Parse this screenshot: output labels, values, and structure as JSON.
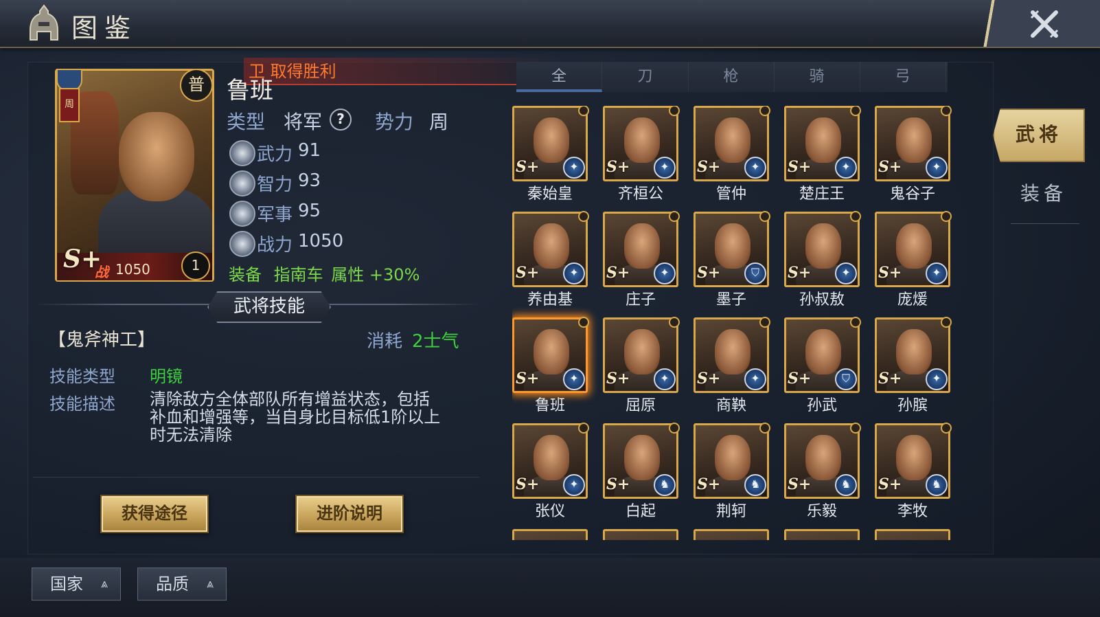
{
  "header": {
    "title": "图鉴",
    "close_label": "✕"
  },
  "banner": {
    "text": "卫 取得胜利"
  },
  "hero": {
    "name": "鲁班",
    "type_label": "类型",
    "type_value": "将军",
    "faction_label": "势力",
    "faction_value": "周",
    "rarity_badge": "普",
    "faction_badge": "周",
    "grade": "S+",
    "power_icon": "战",
    "power_value": "1050",
    "level": "1",
    "stats": [
      {
        "label": "武力",
        "value": "91",
        "icon": "sword-icon"
      },
      {
        "label": "智力",
        "value": "93",
        "icon": "scroll-icon"
      },
      {
        "label": "军事",
        "value": "95",
        "icon": "banner-icon"
      },
      {
        "label": "战力",
        "value": "1050",
        "icon": "blade-icon"
      }
    ],
    "equip_label": "装备",
    "equip_value": "指南车",
    "attr_label": "属性",
    "attr_value": "+30%"
  },
  "skill": {
    "tab_label": "武将技能",
    "name": "【鬼斧神工】",
    "cost_label": "消耗",
    "cost_value": "2士气",
    "type_label": "技能类型",
    "type_value": "明镜",
    "desc_label": "技能描述",
    "desc_value": "清除敌方全体部队所有增益状态，包括补血和增强等，当自身比目标低1阶以上时无法清除"
  },
  "buttons": {
    "obtain": "获得途径",
    "advance": "进阶说明"
  },
  "tabs": [
    "全",
    "刀",
    "枪",
    "骑",
    "弓"
  ],
  "heroes": [
    {
      "name": "秦始皇",
      "grade": "S+",
      "cls": "✦"
    },
    {
      "name": "齐桓公",
      "grade": "S+",
      "cls": "✦"
    },
    {
      "name": "管仲",
      "grade": "S+",
      "cls": "✦"
    },
    {
      "name": "楚庄王",
      "grade": "S+",
      "cls": "✦"
    },
    {
      "name": "鬼谷子",
      "grade": "S+",
      "cls": "✦"
    },
    {
      "name": "养由基",
      "grade": "S+",
      "cls": "✦"
    },
    {
      "name": "庄子",
      "grade": "S+",
      "cls": "✦"
    },
    {
      "name": "墨子",
      "grade": "S+",
      "cls": "⛉"
    },
    {
      "name": "孙叔敖",
      "grade": "S+",
      "cls": "✦"
    },
    {
      "name": "庞煖",
      "grade": "S+",
      "cls": "✦"
    },
    {
      "name": "鲁班",
      "grade": "S+",
      "cls": "✦"
    },
    {
      "name": "屈原",
      "grade": "S+",
      "cls": "✦"
    },
    {
      "name": "商鞅",
      "grade": "S+",
      "cls": "✦"
    },
    {
      "name": "孙武",
      "grade": "S+",
      "cls": "⛉"
    },
    {
      "name": "孙膑",
      "grade": "S+",
      "cls": "✦"
    },
    {
      "name": "张仪",
      "grade": "S+",
      "cls": "✦"
    },
    {
      "name": "白起",
      "grade": "S+",
      "cls": "♞"
    },
    {
      "name": "荆轲",
      "grade": "S+",
      "cls": "♞"
    },
    {
      "name": "乐毅",
      "grade": "S+",
      "cls": "♞"
    },
    {
      "name": "李牧",
      "grade": "S+",
      "cls": "♞"
    }
  ],
  "side_tabs": {
    "active": "武将",
    "other": "装备"
  },
  "filters": {
    "country": "国家",
    "quality": "品质",
    "arrow": "⩓"
  }
}
